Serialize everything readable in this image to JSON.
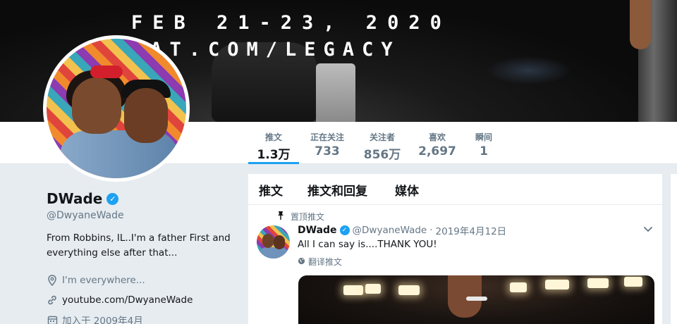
{
  "banner": {
    "line1": "FEB 21-23, 2020",
    "line2": "EAT.COM/LEGACY"
  },
  "stats": [
    {
      "label": "推文",
      "value": "1.3万",
      "active": true
    },
    {
      "label": "正在关注",
      "value": "733"
    },
    {
      "label": "关注者",
      "value": "856万"
    },
    {
      "label": "喜欢",
      "value": "2,697"
    },
    {
      "label": "瞬间",
      "value": "1"
    }
  ],
  "profile": {
    "name": "DWade",
    "verified_mark": "✓",
    "handle": "@DwyaneWade",
    "bio": "From Robbins, IL..I'm a father First and everything else after that...",
    "location": "I'm everywhere...",
    "website": "youtube.com/DwyaneWade",
    "joined": "加入于 2009年4月"
  },
  "timeline": {
    "tabs": [
      "推文",
      "推文和回复",
      "媒体"
    ],
    "pinned_label": "置顶推文",
    "tweet": {
      "name": "DWade",
      "verified_mark": "✓",
      "handle": "@DwyaneWade",
      "separator": "·",
      "date": "2019年4月12日",
      "text": "All I can say is....THANK YOU!",
      "translate_label": "翻译推文"
    }
  },
  "colors": {
    "accent": "#1da1f2",
    "background": "#e6ecf0",
    "secondary_text": "#657786"
  },
  "icons": {
    "verified": "verified-badge-icon",
    "location": "location-pin-icon",
    "link": "link-icon",
    "calendar": "calendar-icon",
    "pin": "pin-icon",
    "globe": "globe-icon",
    "caret": "chevron-down-icon"
  }
}
